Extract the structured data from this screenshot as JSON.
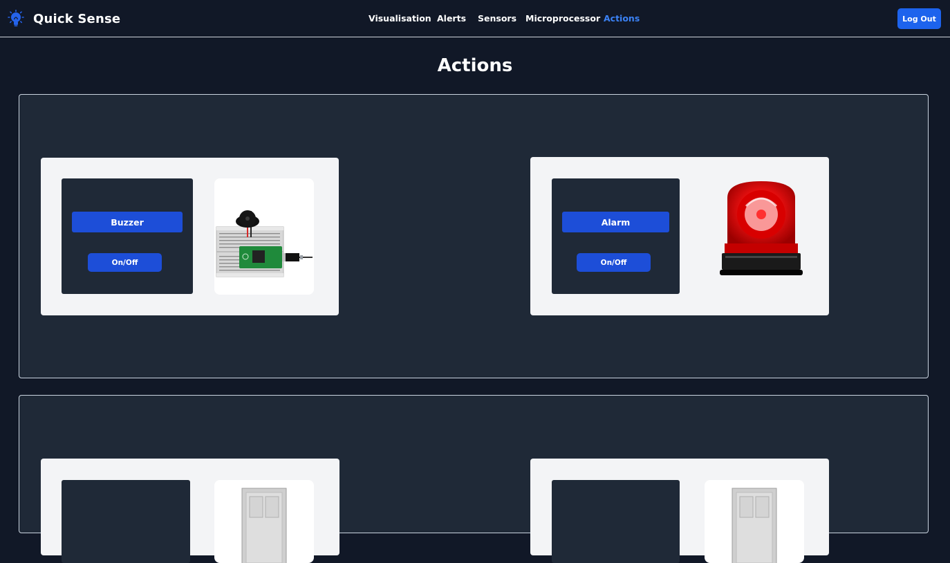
{
  "app": {
    "name": "Quick Sense"
  },
  "nav": {
    "items": [
      {
        "label": "Visualisation",
        "active": false
      },
      {
        "label": "Alerts",
        "active": false
      },
      {
        "label": "Sensors",
        "active": false
      },
      {
        "label": "Microprocessor",
        "active": false
      },
      {
        "label": "Actions",
        "active": true
      }
    ],
    "logout_label": "Log Out"
  },
  "page": {
    "title": "Actions"
  },
  "actions": [
    {
      "label": "Buzzer",
      "toggle_label": "On/Off",
      "image": "buzzer-breadboard-image"
    },
    {
      "label": "Alarm",
      "toggle_label": "On/Off",
      "image": "red-alarm-siren-image"
    },
    {
      "label": "",
      "toggle_label": "",
      "image": "door-image"
    },
    {
      "label": "",
      "toggle_label": "",
      "image": "door-image"
    }
  ],
  "colors": {
    "background": "#111827",
    "panel": "#1f2937",
    "card": "#f3f4f6",
    "primary_button": "#1d4ed8",
    "active_nav": "#3b82f6"
  }
}
